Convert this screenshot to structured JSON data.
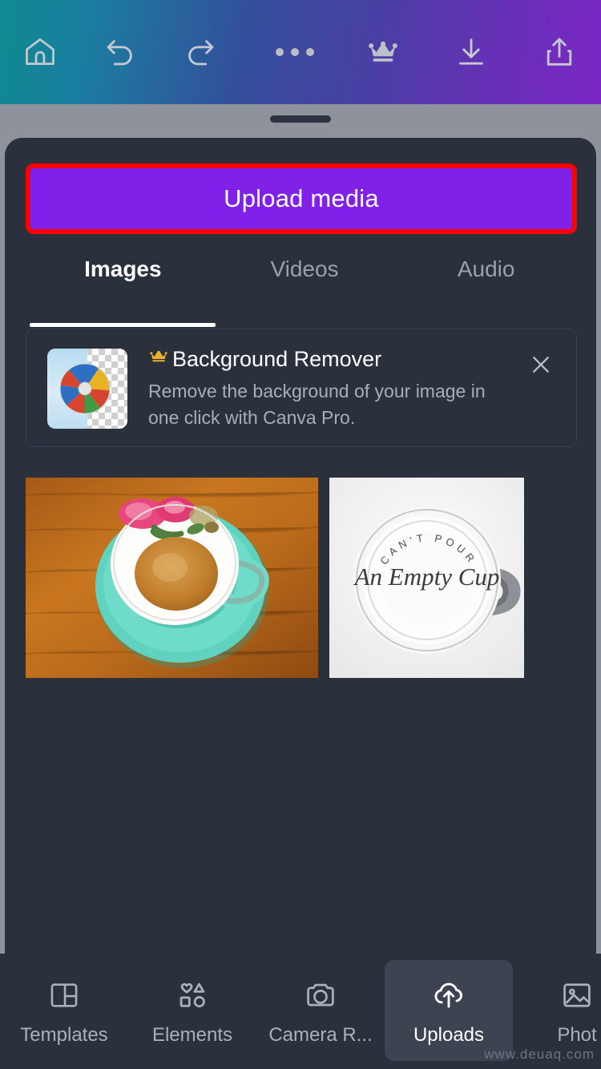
{
  "toolbar": {
    "left_buttons": [
      {
        "name": "home",
        "label": "Home"
      },
      {
        "name": "undo",
        "label": "Undo"
      },
      {
        "name": "redo",
        "label": "Redo"
      }
    ],
    "right_buttons": [
      {
        "name": "more",
        "label": "More options"
      },
      {
        "name": "crown",
        "label": "Canva Pro"
      },
      {
        "name": "download",
        "label": "Download"
      },
      {
        "name": "share",
        "label": "Share"
      }
    ]
  },
  "sheet": {
    "upload_button_label": "Upload media",
    "upload_button_color": "#8020e8",
    "highlight_color": "#fe0000",
    "tabs": [
      {
        "label": "Images",
        "active": true
      },
      {
        "label": "Videos",
        "active": false
      },
      {
        "label": "Audio",
        "active": false
      }
    ],
    "promo": {
      "title": "Background Remover",
      "description": "Remove the background of your image in one click with Canva Pro.",
      "crown_color": "#e8b32c",
      "close_label": "Close"
    },
    "uploads": [
      {
        "name": "floral-teacup-on-mint-saucer",
        "alt": "Floral teacup on mint saucer on wooden table"
      },
      {
        "name": "an-empty-cup-mug",
        "alt": "White mug reading Can't pour from An Empty Cup"
      }
    ]
  },
  "bottom_nav": [
    {
      "label": "Templates",
      "icon": "templates-icon",
      "active": false
    },
    {
      "label": "Elements",
      "icon": "elements-icon",
      "active": false
    },
    {
      "label": "Camera R...",
      "icon": "camera-icon",
      "active": false
    },
    {
      "label": "Uploads",
      "icon": "cloud-upload-icon",
      "active": true
    },
    {
      "label": "Phot",
      "icon": "photos-icon",
      "active": false
    }
  ],
  "watermark": "www.deuaq.com"
}
